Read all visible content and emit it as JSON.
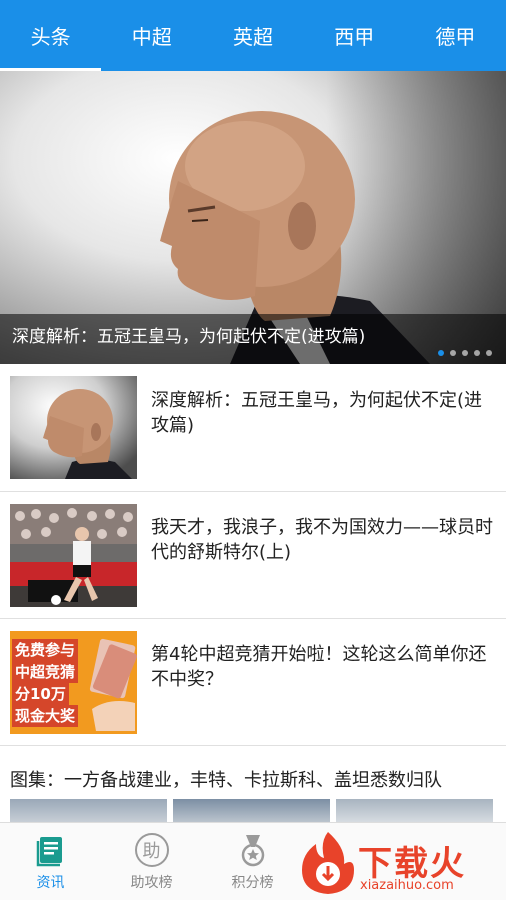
{
  "tabs": [
    "头条",
    "中超",
    "英超",
    "西甲",
    "德甲"
  ],
  "active_tab": 0,
  "hero": {
    "caption": "深度解析：五冠王皇马，为何起伏不定(进攻篇)",
    "dots": 5,
    "active_dot": 0
  },
  "news": [
    {
      "title": "深度解析：五冠王皇马，为何起伏不定(进攻篇)",
      "thumb": "portrait"
    },
    {
      "title": "我天才，我浪子，我不为国效力——球员时代的舒斯特尔(上)",
      "thumb": "match"
    },
    {
      "title": "第4轮中超竞猜开始啦！这轮这么简单你还不中奖？",
      "thumb": "promo",
      "promo_text": [
        "免费参与",
        "中超竞猜",
        "分10万",
        "现金大奖"
      ]
    }
  ],
  "gallery": {
    "title": "图集：一方备战建业，丰特、卡拉斯科、盖坦悉数归队"
  },
  "bottom_nav": [
    {
      "label": "资讯",
      "icon": "news-icon",
      "active": true
    },
    {
      "label": "助攻榜",
      "icon": "assist-icon",
      "glyph": "助",
      "active": false
    },
    {
      "label": "积分榜",
      "icon": "medal-icon",
      "active": false
    }
  ],
  "watermark": {
    "text": "下载火",
    "url": "xiazaihuo.com"
  },
  "colors": {
    "accent": "#1a8fe8",
    "watermark": "#e8432a"
  }
}
